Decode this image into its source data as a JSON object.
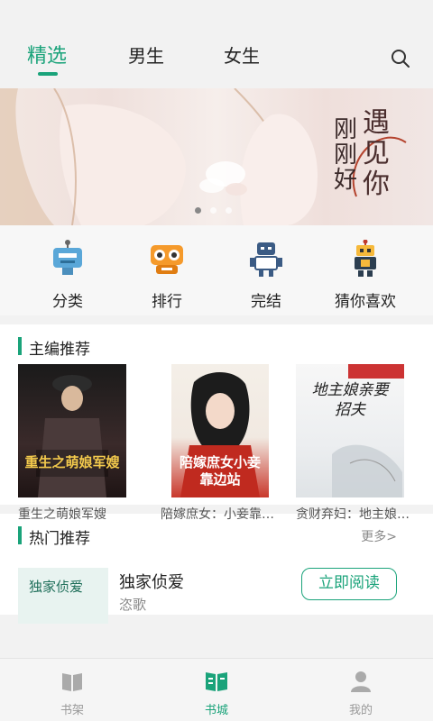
{
  "tabs": [
    {
      "label": "精选",
      "active": true
    },
    {
      "label": "男生",
      "active": false
    },
    {
      "label": "女生",
      "active": false
    }
  ],
  "search_icon": "search-icon",
  "banner": {
    "title_line1": "刚刚好",
    "title_line2": "遇见你",
    "slides": 3,
    "active_slide": 0
  },
  "quick_links": [
    {
      "label": "分类",
      "icon": "robot-blue-icon"
    },
    {
      "label": "排行",
      "icon": "robot-orange-icon"
    },
    {
      "label": "完结",
      "icon": "robot-navy-icon"
    },
    {
      "label": "猜你喜欢",
      "icon": "robot-yellow-icon"
    }
  ],
  "editor_section": {
    "title": "主编推荐",
    "books": [
      {
        "title": "重生之萌娘军嫂",
        "cover_text": "重生之萌娘军嫂"
      },
      {
        "title": "陪嫁庶女：小妾靠…",
        "cover_text": "陪嫁庶女小妾靠边站"
      },
      {
        "title": "贪财弃妇：地主娘…",
        "cover_text": "地主娘亲要招夫"
      }
    ]
  },
  "hot_section": {
    "title": "热门推荐",
    "more": "更多>",
    "items": [
      {
        "title": "独家侦爱",
        "author": "恣歌",
        "cover_text": "独家侦爱",
        "button": "立即阅读"
      }
    ]
  },
  "bottom_nav": [
    {
      "label": "书架",
      "icon": "bookshelf-icon",
      "active": false
    },
    {
      "label": "书城",
      "icon": "bookstore-icon",
      "active": true
    },
    {
      "label": "我的",
      "icon": "profile-icon",
      "active": false
    }
  ],
  "colors": {
    "accent": "#1aa37a",
    "background": "#f2f2f2"
  }
}
